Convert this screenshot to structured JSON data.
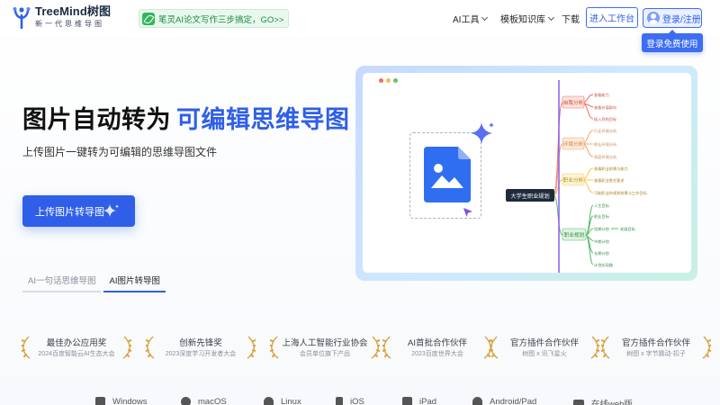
{
  "brand": {
    "name": "TreeMind树图",
    "tagline": "新一代思维导图",
    "color": "#2f5fe8"
  },
  "header": {
    "promo": "笔灵AI论文写作三步搞定，GO>>",
    "nav": [
      {
        "label": "AI工具",
        "has_dropdown": true
      },
      {
        "label": "模板知识库",
        "has_dropdown": true
      },
      {
        "label": "下载",
        "has_dropdown": false
      }
    ],
    "workspace_label": "进入工作台",
    "login_label": "登录/注册",
    "register_label": "登录免费使用"
  },
  "hero": {
    "title_main": "图片自动转为",
    "title_accent": "可编辑思维导图",
    "subtitle": "上传图片一键转为可编辑的思维导图文件",
    "cta_label": "上传图片转导图",
    "tabs": [
      {
        "label": "AI一句话思维导图",
        "active": false
      },
      {
        "label": "AI图片转导图",
        "active": true
      }
    ]
  },
  "preview": {
    "window_dots": [
      "#f26d5b",
      "#f5be4f",
      "#5fc46b"
    ],
    "mindmap": {
      "root": "大学生职业规划",
      "branches": [
        {
          "label": "自我分析",
          "color": "#f06a5a",
          "children": [
            "查看能力",
            "查看价值取向",
            "插入到的目标"
          ]
        },
        {
          "label": "环境分析",
          "color": "#f3a46b",
          "children": [
            "行业环境分析",
            "职业环境分析",
            "家庭环境分析"
          ]
        },
        {
          "label": "职业分析",
          "color": "#f3c74d",
          "children": [
            "查看职业前景与能力",
            "查看职业胜任要求",
            "可能职业的规划前景与工作目标"
          ]
        },
        {
          "label": "职业规划",
          "color": "#56b868",
          "children": [
            "人生目标",
            "职业目标",
            "短期计划",
            "中期计划",
            "长期计划",
            "计划实现路"
          ],
          "sub": "发展目标"
        }
      ]
    }
  },
  "awards": [
    {
      "title": "最佳办公应用奖",
      "sub": "2024百度智能云AI生态大会"
    },
    {
      "title": "创新先锋奖",
      "sub": "2023深度学习开发者大会"
    },
    {
      "title": "上海人工智能行业协会",
      "sub": "会员单位旗下产品"
    },
    {
      "title": "AI首批合作伙伴",
      "sub": "2023百度世界大会"
    },
    {
      "title": "官方插件合作伙伴",
      "sub": "树图 x 讯飞星火"
    },
    {
      "title": "官方插件合作伙伴",
      "sub": "树图 x 字节跳动-扣子"
    }
  ],
  "platforms": [
    "Windows",
    "macOS",
    "Linux",
    "iOS",
    "iPad",
    "Android/Pad",
    "在线web版"
  ]
}
